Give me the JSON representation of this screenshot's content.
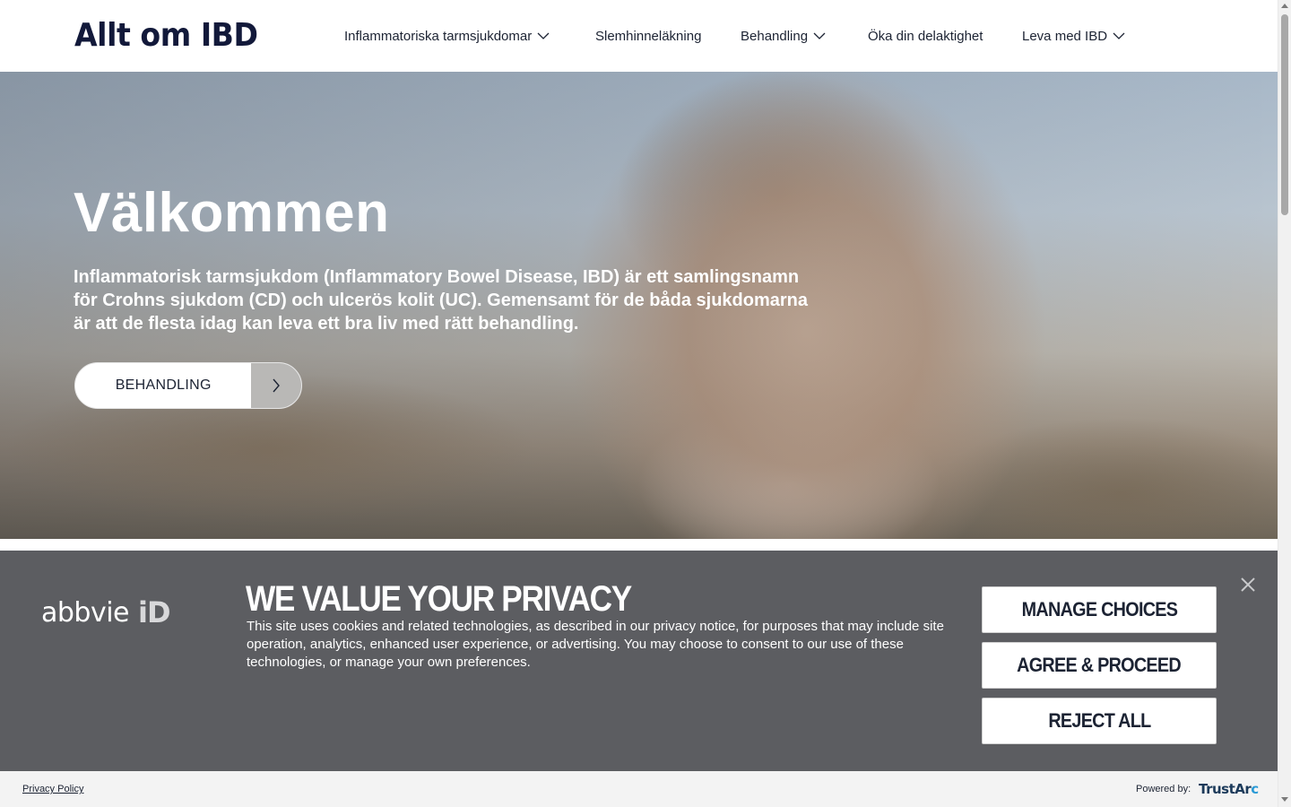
{
  "header": {
    "logo_text": "Allt om IBD",
    "nav": [
      {
        "label": "Inflammatoriska tarmsjukdomar",
        "has_dropdown": true
      },
      {
        "label": "Slemhinneläkning",
        "has_dropdown": false
      },
      {
        "label": "Behandling",
        "has_dropdown": true
      },
      {
        "label": "Öka din delaktighet",
        "has_dropdown": false
      },
      {
        "label": "Leva med IBD",
        "has_dropdown": true
      }
    ]
  },
  "hero": {
    "title": "Välkommen",
    "text": "Inflammatorisk tarmsjukdom (Inflammatory Bowel Disease, IBD) är ett samlingsnamn för Crohns sjukdom (CD) och ulcerös kolit (UC). Gemensamt för de båda sjukdomarna är att de flesta idag kan leva ett bra liv med rätt behandling.",
    "button_label": "BEHANDLING",
    "button_icon": "chevron-right-icon"
  },
  "cookie_banner": {
    "brand_word": "abbvie",
    "brand_id": "iD",
    "title": "WE VALUE YOUR PRIVACY",
    "text": "This site uses cookies and related technologies, as described in our privacy notice, for purposes that may include site operation, analytics, enhanced user experience, or advertising. You may choose to consent to our use of these technologies, or manage your own preferences.",
    "buttons": {
      "manage": "MANAGE CHOICES",
      "agree": "AGREE & PROCEED",
      "reject": "REJECT ALL"
    },
    "close_icon": "close-icon",
    "background_color": "#5c5d61"
  },
  "footer_bar": {
    "privacy_link": "Privacy Policy",
    "powered_by": "Powered by:",
    "powered_brand_a": "TrustAr",
    "powered_brand_b": "c"
  },
  "colors": {
    "brand_dark": "#12193a",
    "text": "#1c2333",
    "banner": "#5c5d61"
  }
}
